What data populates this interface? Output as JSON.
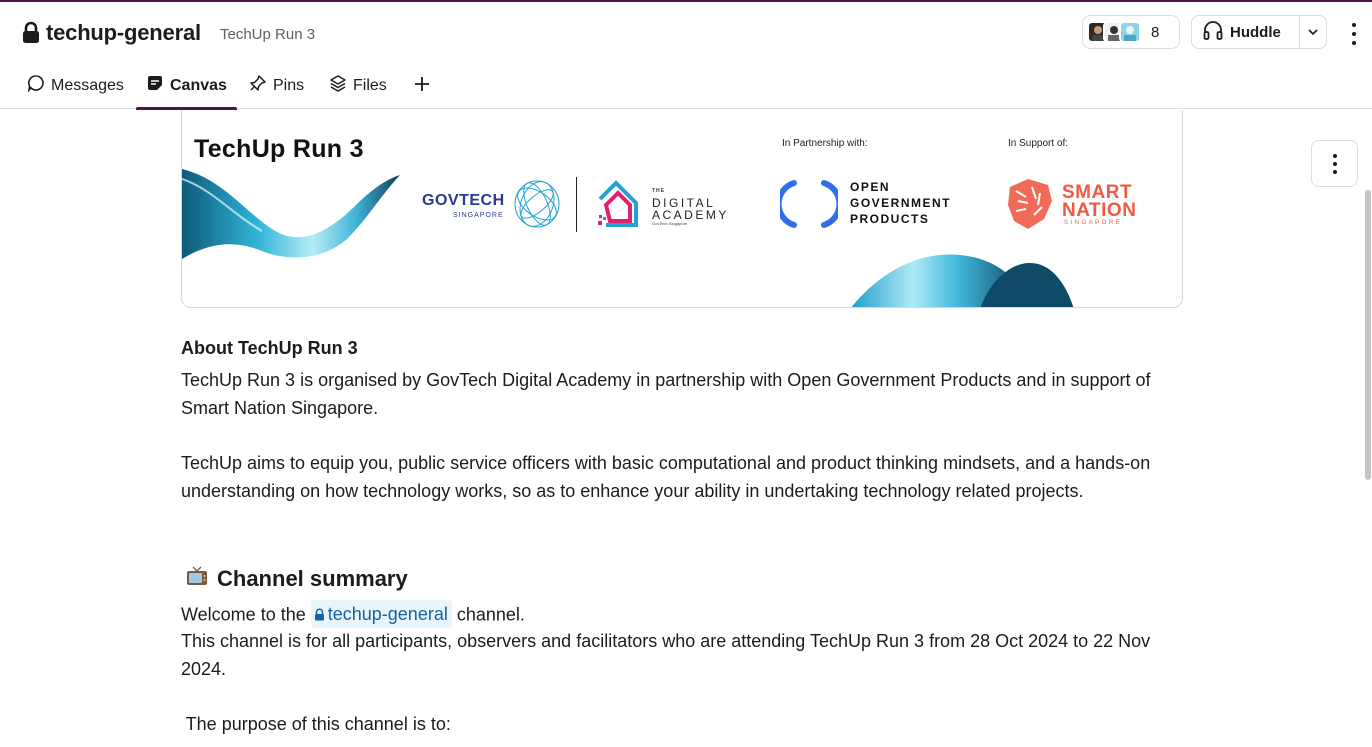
{
  "channel": {
    "name": "techup-general",
    "canvas_title": "TechUp Run 3",
    "member_count": "8"
  },
  "huddle": {
    "label": "Huddle"
  },
  "tabs": [
    {
      "label": "Messages"
    },
    {
      "label": "Canvas"
    },
    {
      "label": "Pins"
    },
    {
      "label": "Files"
    }
  ],
  "banner": {
    "title": "TechUp Run 3",
    "partnership_label": "In Partnership with:",
    "support_label": "In Support of:",
    "govtech_name": "GOVTECH",
    "govtech_sub": "SINGAPORE",
    "academy_the": "THE",
    "academy_line1": "DIGITAL",
    "academy_line2": "ACADEMY",
    "academy_sub": "GovTech Singapore",
    "ogp_line1": "OPEN",
    "ogp_line2": "GOVERNMENT",
    "ogp_line3": "PRODUCTS",
    "sn_line1": "SMART",
    "sn_line2": "NATION",
    "sn_sub": "SINGAPORE"
  },
  "about": {
    "heading": "About TechUp Run 3",
    "para1": "TechUp Run 3 is organised by GovTech Digital Academy in partnership with Open Government Products and in support of Smart Nation Singapore.",
    "para2": "TechUp aims to equip you, public service officers with basic computational and product thinking mindsets, and a hands-on understanding on how technology works, so as to enhance your ability in undertaking technology related projects."
  },
  "summary": {
    "heading": "Channel summary",
    "welcome_prefix": "Welcome to the",
    "channel_link": "techup-general",
    "welcome_suffix": "channel.",
    "description": "This channel is for all participants, observers and facilitators who are attending TechUp Run 3 from 28 Oct 2024 to 22 Nov 2024.",
    "purpose": " The purpose of this channel is to:"
  },
  "colors": {
    "accent": "#4a154b",
    "link": "#1264a3",
    "link_bg": "#e8f5fa",
    "smart_nation": "#ef5a45",
    "academy_pink": "#e0206e",
    "ogp_blue": "#2f6fe8"
  },
  "icons": {
    "lock": "lock-icon",
    "headphones": "headphones-icon",
    "chat": "chat-bubble-icon",
    "canvas": "canvas-icon",
    "pin": "pin-icon",
    "files": "layers-icon",
    "add": "plus-icon",
    "more": "kebab-icon",
    "tv": "television-emoji"
  }
}
